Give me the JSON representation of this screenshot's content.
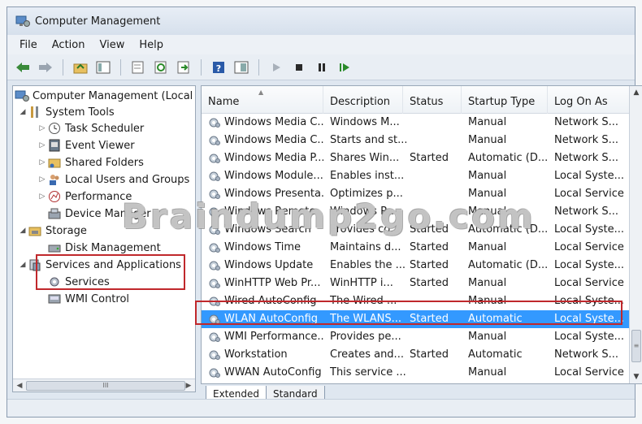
{
  "window": {
    "title": "Computer Management"
  },
  "menu": [
    "File",
    "Action",
    "View",
    "Help"
  ],
  "toolbar": [
    "back-icon",
    "forward-icon",
    "up-folder-icon",
    "console-tree-icon",
    "properties-icon",
    "refresh-icon",
    "export-icon",
    "help-icon",
    "show-hide-icon",
    "start-icon",
    "stop-icon",
    "pause-icon",
    "restart-icon"
  ],
  "tree": {
    "root": "Computer Management (Local",
    "system_tools": "System Tools",
    "task_scheduler": "Task Scheduler",
    "event_viewer": "Event Viewer",
    "shared_folders": "Shared Folders",
    "local_users": "Local Users and Groups",
    "performance": "Performance",
    "device_manager": "Device Manager",
    "storage": "Storage",
    "disk_management": "Disk Management",
    "services_apps": "Services and Applications",
    "services": "Services",
    "wmi_control": "WMI Control",
    "scroll_grip": "III"
  },
  "columns": [
    "Name",
    "Description",
    "Status",
    "Startup Type",
    "Log On As"
  ],
  "rows": [
    [
      "Windows Media C...",
      "Windows M...",
      "",
      "Manual",
      "Network S..."
    ],
    [
      "Windows Media C...",
      "Starts and st...",
      "",
      "Manual",
      "Network S..."
    ],
    [
      "Windows Media P...",
      "Shares Win...",
      "Started",
      "Automatic (D...",
      "Network S..."
    ],
    [
      "Windows Module...",
      "Enables inst...",
      "",
      "Manual",
      "Local Syste..."
    ],
    [
      "Windows Presenta...",
      "Optimizes p...",
      "",
      "Manual",
      "Local Service"
    ],
    [
      "Windows Remote...",
      "Windows R...",
      "",
      "Manual",
      "Network S..."
    ],
    [
      "Windows Search",
      "Provides co...",
      "Started",
      "Automatic (D...",
      "Local Syste..."
    ],
    [
      "Windows Time",
      "Maintains d...",
      "Started",
      "Manual",
      "Local Service"
    ],
    [
      "Windows Update",
      "Enables the ...",
      "Started",
      "Automatic (D...",
      "Local Syste..."
    ],
    [
      "WinHTTP Web Pr...",
      "WinHTTP i...",
      "Started",
      "Manual",
      "Local Service"
    ],
    [
      "Wired AutoConfig",
      "The Wired ...",
      "",
      "Manual",
      "Local Syste..."
    ],
    [
      "WLAN AutoConfig",
      "The WLANS...",
      "Started",
      "Automatic",
      "Local Syste..."
    ],
    [
      "WMI Performance...",
      "Provides pe...",
      "",
      "Manual",
      "Local Syste..."
    ],
    [
      "Workstation",
      "Creates and...",
      "Started",
      "Automatic",
      "Network S..."
    ],
    [
      "WWAN AutoConfig",
      "This service ...",
      "",
      "Manual",
      "Local Service"
    ]
  ],
  "selected_row": "WLAN AutoConfig",
  "tabs": [
    "Extended",
    "Standard"
  ],
  "watermark": "Braindump2go.com",
  "colors": {
    "selection": "#3399ff",
    "highlight_box": "#c0282c"
  }
}
